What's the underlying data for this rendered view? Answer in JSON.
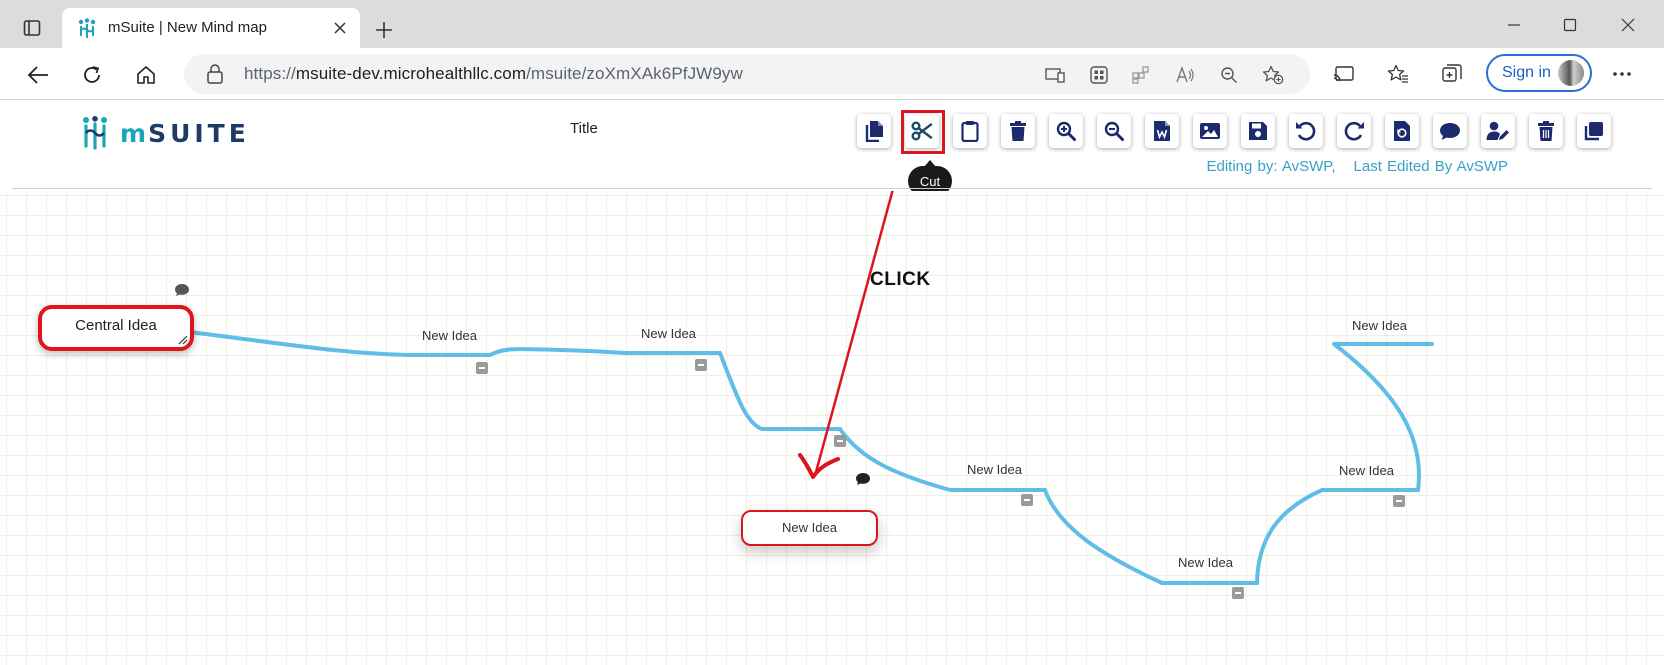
{
  "browser": {
    "tab_title": "mSuite | New Mind map",
    "url_prefix": "https://",
    "url_host": "msuite-dev.microhealthllc.com",
    "url_path": "/msuite/zoXmXAk6PfJW9yw",
    "signin_label": "Sign in"
  },
  "app": {
    "logo_text_m": "m",
    "logo_text_rest": "SUITE",
    "title": "Title",
    "editing_by": "Editing by: AvSWP,",
    "last_edited_by": "Last Edited By AvSWP",
    "tooltip": "Cut",
    "annotation": "CLICK",
    "toolbar": [
      {
        "name": "copy",
        "icon": "copy-icon"
      },
      {
        "name": "cut",
        "icon": "scissors-icon"
      },
      {
        "name": "paste",
        "icon": "clipboard-icon"
      },
      {
        "name": "delete",
        "icon": "trash-icon"
      },
      {
        "name": "zoom-in",
        "icon": "zoom-in-icon"
      },
      {
        "name": "zoom-out",
        "icon": "zoom-out-icon"
      },
      {
        "name": "export-word",
        "icon": "word-file-icon"
      },
      {
        "name": "export-image",
        "icon": "image-icon"
      },
      {
        "name": "save",
        "icon": "save-icon"
      },
      {
        "name": "undo",
        "icon": "undo-icon"
      },
      {
        "name": "redo",
        "icon": "redo-icon"
      },
      {
        "name": "reset",
        "icon": "reset-icon"
      },
      {
        "name": "comment",
        "icon": "comment-icon"
      },
      {
        "name": "edit-user",
        "icon": "user-edit-icon"
      },
      {
        "name": "delete-map",
        "icon": "trash-icon"
      },
      {
        "name": "duplicate",
        "icon": "duplicate-icon"
      }
    ]
  },
  "mindmap": {
    "central": "Central Idea",
    "nodes": [
      "New Idea",
      "New Idea",
      "New Idea",
      "New Idea",
      "New Idea",
      "New Idea",
      "New Idea"
    ],
    "colors": {
      "link": "#5fbde8",
      "highlight": "#e0141e",
      "accent": "#1aa6b7",
      "brand": "#1e3a66"
    }
  }
}
